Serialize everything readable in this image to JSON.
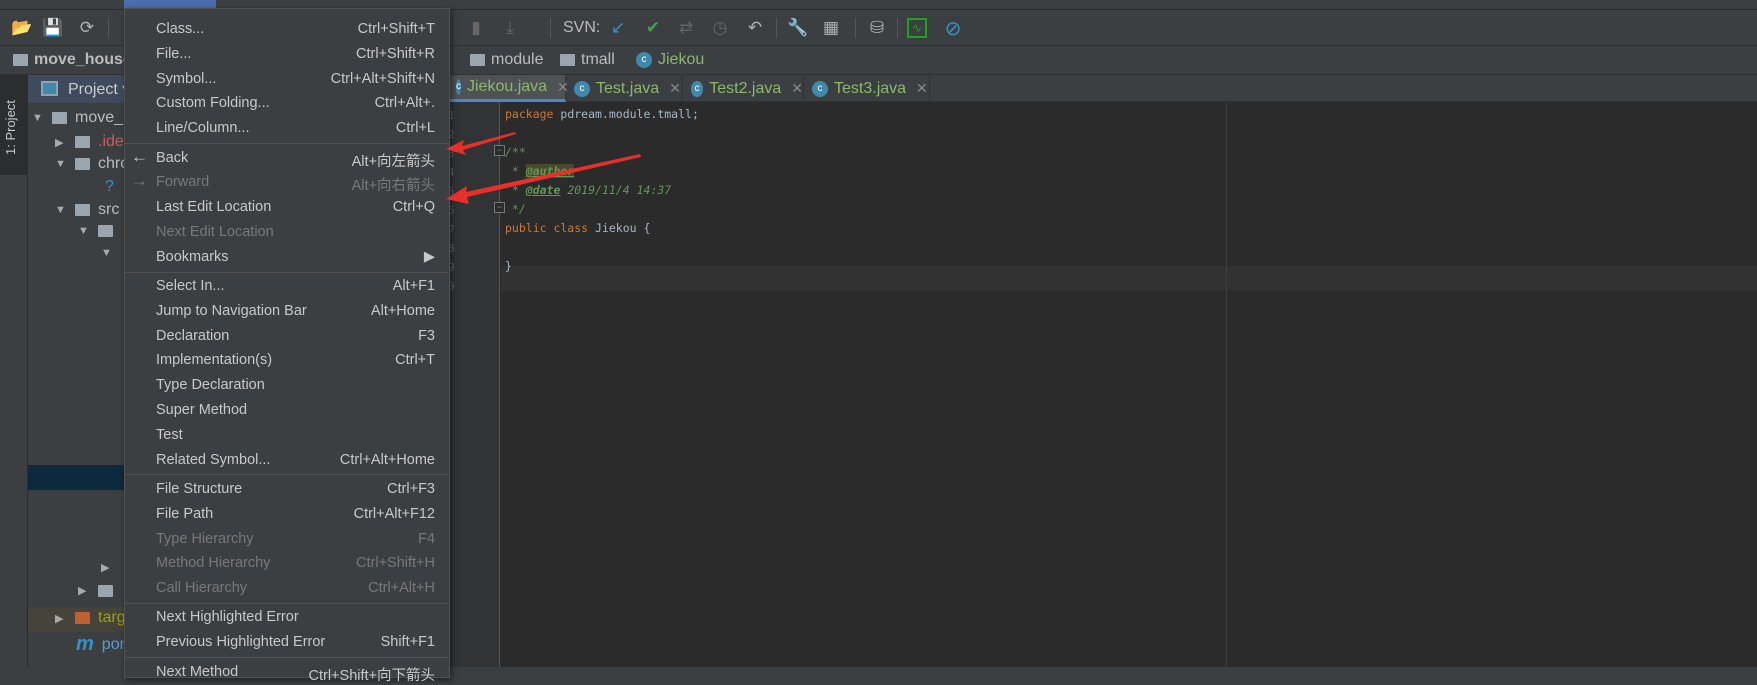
{
  "toolbar": {
    "svn_label": "SVN:",
    "icons": [
      "open-folder-icon",
      "save-icon",
      "sync-icon",
      "svn-update-icon",
      "svn-commit-icon",
      "svn-compare-icon",
      "svn-history-icon",
      "svn-revert-icon",
      "wrench-icon",
      "project-structure-icon",
      "sdk-icon",
      "profiler-icon",
      "no-entry-icon"
    ]
  },
  "breadcrumb": [
    "move_house",
    "module",
    "tmall",
    "Jiekou"
  ],
  "project": {
    "title": "Project",
    "strip_label": "1: Project",
    "tree": [
      ".ide",
      "chro",
      "src",
      "targ",
      "pom",
      "move_h"
    ]
  },
  "tabs": [
    {
      "label": "Jiekou.java",
      "active": true
    },
    {
      "label": "Test.java"
    },
    {
      "label": "Test2.java"
    },
    {
      "label": "Test3.java"
    }
  ],
  "editor": {
    "line_numbers": [
      "1",
      "2",
      "3",
      "4",
      "5",
      "6",
      "7",
      "8",
      "9",
      "0"
    ],
    "code": {
      "l1_kw": "package",
      "l1_rest": " pdream.module.tmall;",
      "l3": "/**",
      "l4_star": " * ",
      "l4_tag": "@author",
      "l5_star": " * ",
      "l5_tag": "@date",
      "l5_rest": " 2019/11/4 14:37",
      "l6": " */",
      "l7_kw": "public class",
      "l7_rest": " Jiekou {",
      "l9": "}"
    }
  },
  "menu": {
    "items": [
      {
        "label": "Class...",
        "shortcut": "Ctrl+Shift+T"
      },
      {
        "label": "File...",
        "shortcut": "Ctrl+Shift+R"
      },
      {
        "label": "Symbol...",
        "shortcut": "Ctrl+Alt+Shift+N"
      },
      {
        "label": "Custom Folding...",
        "shortcut": "Ctrl+Alt+."
      },
      {
        "label": "Line/Column...",
        "shortcut": "Ctrl+L"
      },
      {
        "label": "Back",
        "shortcut": "Alt+向左箭头",
        "icon": "arrow-left-icon"
      },
      {
        "label": "Forward",
        "shortcut": "Alt+向右箭头",
        "icon": "arrow-right-icon",
        "disabled": true
      },
      {
        "label": "Last Edit Location",
        "shortcut": "Ctrl+Q"
      },
      {
        "label": "Next Edit Location",
        "shortcut": "",
        "disabled": true
      },
      {
        "label": "Bookmarks",
        "shortcut": "▶"
      },
      {
        "label": "Select In...",
        "shortcut": "Alt+F1"
      },
      {
        "label": "Jump to Navigation Bar",
        "shortcut": "Alt+Home"
      },
      {
        "label": "Declaration",
        "shortcut": "F3"
      },
      {
        "label": "Implementation(s)",
        "shortcut": "Ctrl+T"
      },
      {
        "label": "Type Declaration",
        "shortcut": ""
      },
      {
        "label": "Super Method",
        "shortcut": ""
      },
      {
        "label": "Test",
        "shortcut": ""
      },
      {
        "label": "Related Symbol...",
        "shortcut": "Ctrl+Alt+Home"
      },
      {
        "label": "File Structure",
        "shortcut": "Ctrl+F3"
      },
      {
        "label": "File Path",
        "shortcut": "Ctrl+Alt+F12"
      },
      {
        "label": "Type Hierarchy",
        "shortcut": "F4",
        "disabled": true
      },
      {
        "label": "Method Hierarchy",
        "shortcut": "Ctrl+Shift+H",
        "disabled": true
      },
      {
        "label": "Call Hierarchy",
        "shortcut": "Ctrl+Alt+H",
        "disabled": true
      },
      {
        "label": "Next Highlighted Error",
        "shortcut": ""
      },
      {
        "label": "Previous Highlighted Error",
        "shortcut": "Shift+F1"
      },
      {
        "label": "Next Method",
        "shortcut": "Ctrl+Shift+向下箭头"
      }
    ],
    "separators_after": [
      4,
      9,
      17,
      22,
      24
    ]
  },
  "colors": {
    "accent": "#4b6eaf",
    "annotation_arrow": "#e8302a",
    "editor_bg": "#2b2b2b",
    "menu_bg": "#3c3f41"
  }
}
